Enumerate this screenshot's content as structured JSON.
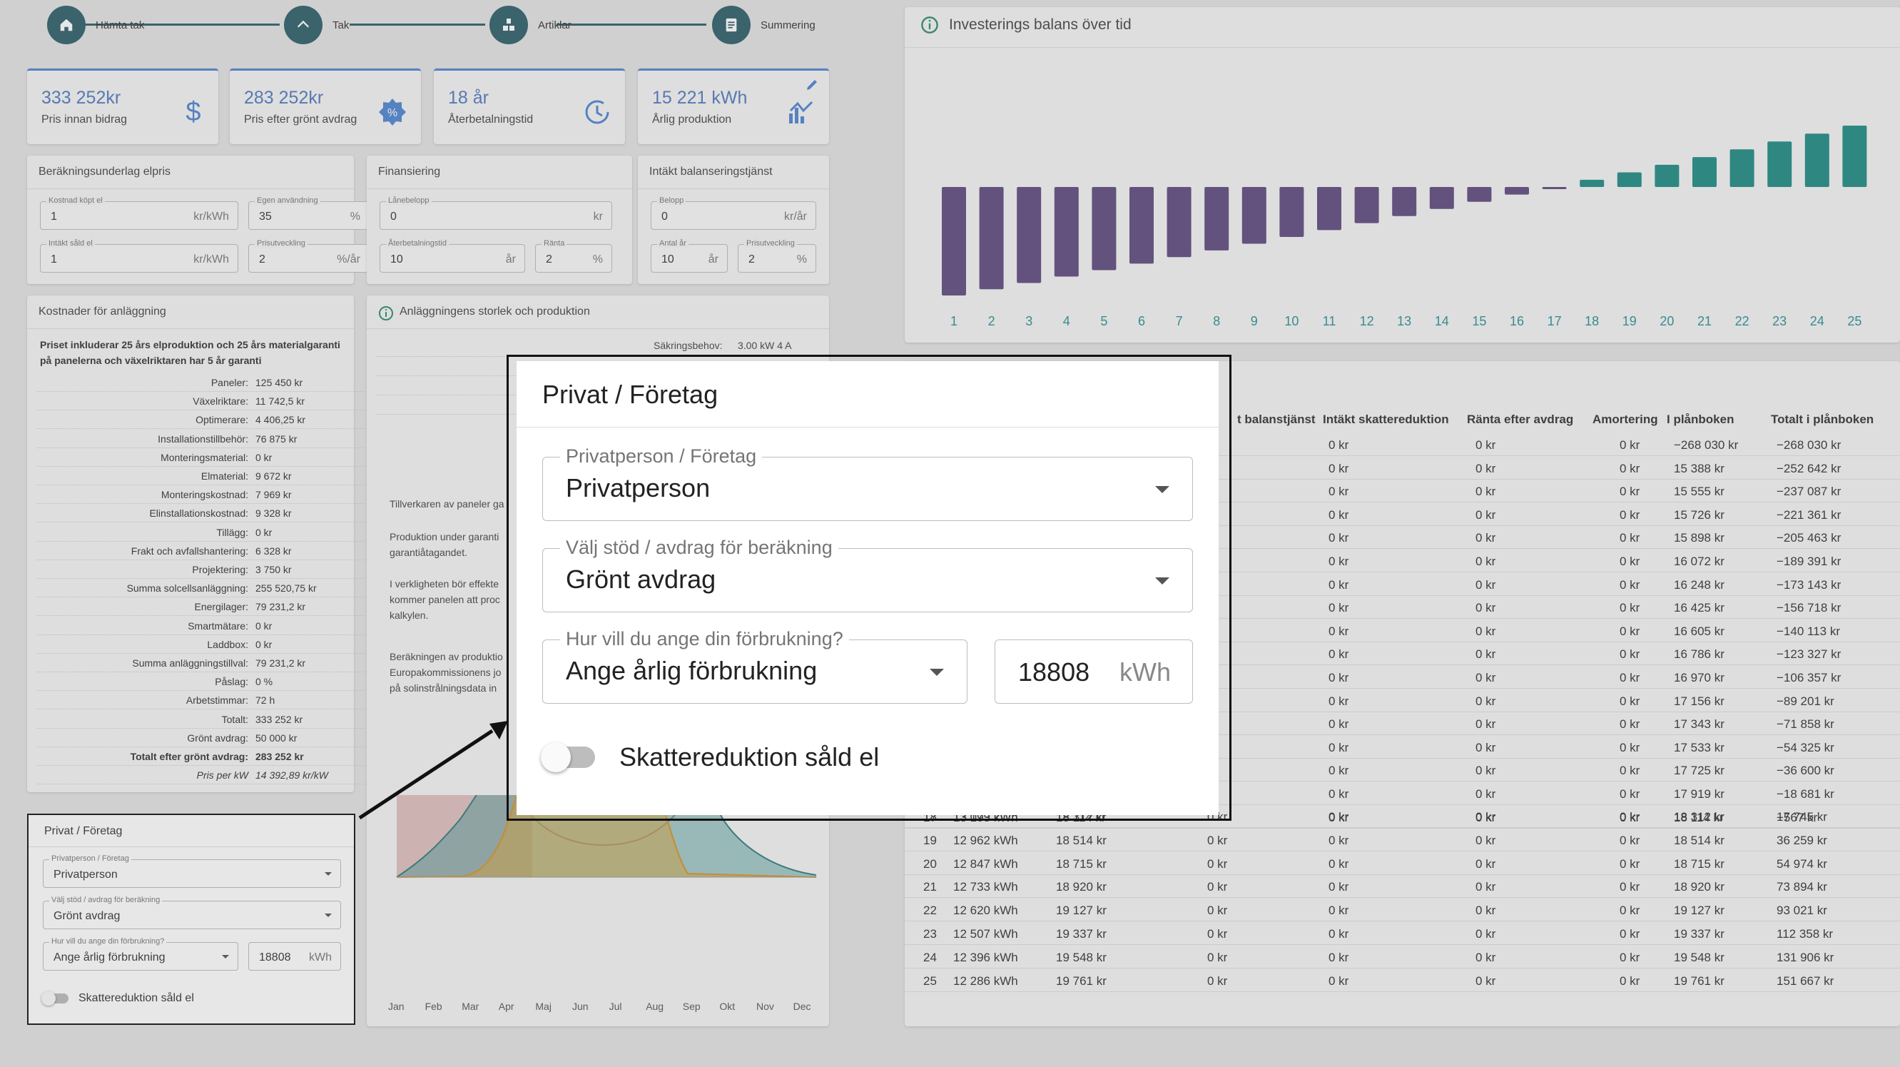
{
  "stepper": {
    "steps": [
      {
        "label": "Hämta tak",
        "icon": "home-icon"
      },
      {
        "label": "Tak",
        "icon": "roof-icon"
      },
      {
        "label": "Artiklar",
        "icon": "items-icon"
      },
      {
        "label": "Summering",
        "icon": "summary-icon"
      }
    ]
  },
  "kpis": [
    {
      "value": "333 252kr",
      "label": "Pris innan bidrag",
      "icon": "dollar-icon"
    },
    {
      "value": "283 252kr",
      "label": "Pris efter grönt avdrag",
      "icon": "discount-badge-icon"
    },
    {
      "value": "18 år",
      "label": "Återbetalningstid",
      "icon": "history-clock-icon"
    },
    {
      "value": "15 221 kWh",
      "label": "Årlig produktion",
      "icon": "production-chart-icon"
    }
  ],
  "elpris": {
    "title": "Beräkningsunderlag elpris",
    "fields": [
      {
        "label": "Kostnad köpt el",
        "value": "1",
        "unit": "kr/kWh"
      },
      {
        "label": "Egen användning",
        "value": "35",
        "unit": "%"
      },
      {
        "label": "Intäkt såld el",
        "value": "1",
        "unit": "kr/kWh"
      },
      {
        "label": "Prisutveckling",
        "value": "2",
        "unit": "%/år"
      }
    ]
  },
  "finansiering": {
    "title": "Finansiering",
    "fields": [
      {
        "label": "Lånebelopp",
        "value": "0",
        "unit": "kr"
      },
      {
        "label": "Återbetalningstid",
        "value": "10",
        "unit": "år"
      },
      {
        "label": "Ränta",
        "value": "2",
        "unit": "%"
      }
    ]
  },
  "balans": {
    "title": "Intäkt balanseringstjänst",
    "fields": [
      {
        "label": "Belopp",
        "value": "0",
        "unit": "kr/år"
      },
      {
        "label": "Antal år",
        "value": "10",
        "unit": "år"
      },
      {
        "label": "Prisutveckling",
        "value": "2",
        "unit": "%"
      }
    ]
  },
  "costs": {
    "title": "Kostnader för anläggning",
    "note": "Priset inkluderar 25 års elproduktion och 25 års materialgaranti på panelerna och växelriktaren har 5 år garanti",
    "rows": [
      {
        "label": "Paneler:",
        "value": "125 450 kr"
      },
      {
        "label": "Växelriktare:",
        "value": "11 742,5 kr"
      },
      {
        "label": "Optimerare:",
        "value": "4 406,25 kr"
      },
      {
        "label": "Installationstillbehör:",
        "value": "76 875 kr"
      },
      {
        "label": "Monteringsmaterial:",
        "value": "0 kr"
      },
      {
        "label": "Elmaterial:",
        "value": "9 672 kr"
      },
      {
        "label": "Monteringskostnad:",
        "value": "7 969 kr"
      },
      {
        "label": "Elinstallationskostnad:",
        "value": "9 328 kr"
      },
      {
        "label": "Tillägg:",
        "value": "0 kr"
      },
      {
        "label": "Frakt och avfallshantering:",
        "value": "6 328 kr"
      },
      {
        "label": "Projektering:",
        "value": "3 750 kr"
      },
      {
        "label": "Summa solcellsanläggning:",
        "value": "255 520,75 kr"
      },
      {
        "label": "Energilager:",
        "value": "79 231,2 kr"
      },
      {
        "label": "Smartmätare:",
        "value": "0 kr"
      },
      {
        "label": "Laddbox:",
        "value": "0 kr"
      },
      {
        "label": "Summa anläggningstillval:",
        "value": "79 231,2 kr"
      },
      {
        "label": "Påslag:",
        "value": "0 %"
      },
      {
        "label": "Arbetstimmar:",
        "value": "72 h"
      },
      {
        "label": "Totalt:",
        "value": "333 252 kr"
      },
      {
        "label": "Grönt avdrag:",
        "value": "50 000 kr"
      },
      {
        "label": "Totalt efter grönt avdrag:",
        "value": "283 252 kr",
        "bold": true
      },
      {
        "label": "Pris per kW",
        "value": "14 392,89 kr/kW",
        "italic": true
      }
    ]
  },
  "production": {
    "title": "Anläggningens storlek och produktion",
    "sakring_label": "Säkringsbehov:",
    "sakring_value": "3.00 kW 4 A",
    "text_lines": [
      "Tillverkaren av paneler ga",
      "Produktion under garanti",
      "garantiåtagandet.",
      "I verkligheten bör effekte",
      "kommer panelen att proc",
      "kalkylen.",
      "Beräkningen av produktio",
      "Europakommissionens jo",
      "på solinstrålningsdata in"
    ],
    "months": [
      "Jan",
      "Feb",
      "Mar",
      "Apr",
      "Maj",
      "Jun",
      "Jul",
      "Aug",
      "Sep",
      "Okt",
      "Nov",
      "Dec"
    ]
  },
  "small_form": {
    "title": "Privat / Företag",
    "type_label": "Privatperson / Företag",
    "type_value": "Privatperson",
    "support_label": "Välj stöd / avdrag för beräkning",
    "support_value": "Grönt avdrag",
    "usage_label": "Hur vill du ange din förbrukning?",
    "usage_value": "Ange årlig förbrukning",
    "kwh_value": "18808",
    "kwh_unit": "kWh",
    "toggle_label": "Skattereduktion såld el"
  },
  "dialog": {
    "title": "Privat / Företag",
    "type_label": "Privatperson / Företag",
    "type_value": "Privatperson",
    "support_label": "Välj stöd / avdrag för beräkning",
    "support_value": "Grönt avdrag",
    "usage_label": "Hur vill du ange din förbrukning?",
    "usage_value": "Ange årlig förbrukning",
    "kwh_value": "18808",
    "kwh_unit": "kWh",
    "toggle_label": "Skattereduktion såld el",
    "toggle_on": false
  },
  "chart_data": {
    "type": "bar",
    "title": "Investerings balans över tid",
    "categories": [
      "1",
      "2",
      "3",
      "4",
      "5",
      "6",
      "7",
      "8",
      "9",
      "10",
      "11",
      "12",
      "13",
      "14",
      "15",
      "16",
      "17",
      "18",
      "19",
      "20",
      "21",
      "22",
      "23",
      "24",
      "25"
    ],
    "values": [
      -268030,
      -252642,
      -237087,
      -221361,
      -205463,
      -189391,
      -173143,
      -156718,
      -140113,
      -123327,
      -106357,
      -89201,
      -71858,
      -54325,
      -36600,
      -18681,
      -567,
      17745,
      36259,
      54974,
      73894,
      93021,
      112358,
      131906,
      151667
    ],
    "negative_color": "#5e4a7e",
    "positive_color": "#1f8a84"
  },
  "table": {
    "headers": [
      "t balanstjänst",
      "Intäkt skattereduktion",
      "Ränta efter avdrag",
      "Amortering",
      "I plånboken",
      "Totalt i plånboken"
    ],
    "upper_rows": [
      {
        "b": "0 kr",
        "c": "0 kr",
        "d": "0 kr",
        "e": "−268 030 kr",
        "f": "−268 030 kr"
      },
      {
        "b": "0 kr",
        "c": "0 kr",
        "d": "0 kr",
        "e": "15 388 kr",
        "f": "−252 642 kr"
      },
      {
        "b": "0 kr",
        "c": "0 kr",
        "d": "0 kr",
        "e": "15 555 kr",
        "f": "−237 087 kr"
      },
      {
        "b": "0 kr",
        "c": "0 kr",
        "d": "0 kr",
        "e": "15 726 kr",
        "f": "−221 361 kr"
      },
      {
        "b": "0 kr",
        "c": "0 kr",
        "d": "0 kr",
        "e": "15 898 kr",
        "f": "−205 463 kr"
      },
      {
        "b": "0 kr",
        "c": "0 kr",
        "d": "0 kr",
        "e": "16 072 kr",
        "f": "−189 391 kr"
      },
      {
        "b": "0 kr",
        "c": "0 kr",
        "d": "0 kr",
        "e": "16 248 kr",
        "f": "−173 143 kr"
      },
      {
        "b": "0 kr",
        "c": "0 kr",
        "d": "0 kr",
        "e": "16 425 kr",
        "f": "−156 718 kr"
      },
      {
        "b": "0 kr",
        "c": "0 kr",
        "d": "0 kr",
        "e": "16 605 kr",
        "f": "−140 113 kr"
      },
      {
        "b": "0 kr",
        "c": "0 kr",
        "d": "0 kr",
        "e": "16 786 kr",
        "f": "−123 327 kr"
      },
      {
        "b": "0 kr",
        "c": "0 kr",
        "d": "0 kr",
        "e": "16 970 kr",
        "f": "−106 357 kr"
      },
      {
        "b": "0 kr",
        "c": "0 kr",
        "d": "0 kr",
        "e": "17 156 kr",
        "f": "−89 201 kr"
      },
      {
        "b": "0 kr",
        "c": "0 kr",
        "d": "0 kr",
        "e": "17 343 kr",
        "f": "−71 858 kr"
      },
      {
        "b": "0 kr",
        "c": "0 kr",
        "d": "0 kr",
        "e": "17 533 kr",
        "f": "−54 325 kr"
      },
      {
        "b": "0 kr",
        "c": "0 kr",
        "d": "0 kr",
        "e": "17 725 kr",
        "f": "−36 600 kr"
      },
      {
        "b": "0 kr",
        "c": "0 kr",
        "d": "0 kr",
        "e": "17 919 kr",
        "f": "−18 681 kr"
      }
    ],
    "row17": {
      "y": "17",
      "p": "13 193 kWh",
      "s": "18 114 kr",
      "b": "0 kr",
      "c": "0 kr",
      "d": "0 kr",
      "e": "18 114 kr",
      "f": "−567 kr"
    },
    "lower_rows": [
      {
        "y": "18",
        "p": "13 079 kWh",
        "s": "18 312 kr",
        "a": "0 kr",
        "b": "0 kr",
        "c": "0 kr",
        "d": "0 kr",
        "e": "18 312 kr",
        "f": "17 745 kr"
      },
      {
        "y": "19",
        "p": "12 962 kWh",
        "s": "18 514 kr",
        "a": "0 kr",
        "b": "0 kr",
        "c": "0 kr",
        "d": "0 kr",
        "e": "18 514 kr",
        "f": "36 259 kr"
      },
      {
        "y": "20",
        "p": "12 847 kWh",
        "s": "18 715 kr",
        "a": "0 kr",
        "b": "0 kr",
        "c": "0 kr",
        "d": "0 kr",
        "e": "18 715 kr",
        "f": "54 974 kr"
      },
      {
        "y": "21",
        "p": "12 733 kWh",
        "s": "18 920 kr",
        "a": "0 kr",
        "b": "0 kr",
        "c": "0 kr",
        "d": "0 kr",
        "e": "18 920 kr",
        "f": "73 894 kr"
      },
      {
        "y": "22",
        "p": "12 620 kWh",
        "s": "19 127 kr",
        "a": "0 kr",
        "b": "0 kr",
        "c": "0 kr",
        "d": "0 kr",
        "e": "19 127 kr",
        "f": "93 021 kr"
      },
      {
        "y": "23",
        "p": "12 507 kWh",
        "s": "19 337 kr",
        "a": "0 kr",
        "b": "0 kr",
        "c": "0 kr",
        "d": "0 kr",
        "e": "19 337 kr",
        "f": "112 358 kr"
      },
      {
        "y": "24",
        "p": "12 396 kWh",
        "s": "19 548 kr",
        "a": "0 kr",
        "b": "0 kr",
        "c": "0 kr",
        "d": "0 kr",
        "e": "19 548 kr",
        "f": "131 906 kr"
      },
      {
        "y": "25",
        "p": "12 286 kWh",
        "s": "19 761 kr",
        "a": "0 kr",
        "b": "0 kr",
        "c": "0 kr",
        "d": "0 kr",
        "e": "19 761 kr",
        "f": "151 667 kr"
      }
    ]
  }
}
